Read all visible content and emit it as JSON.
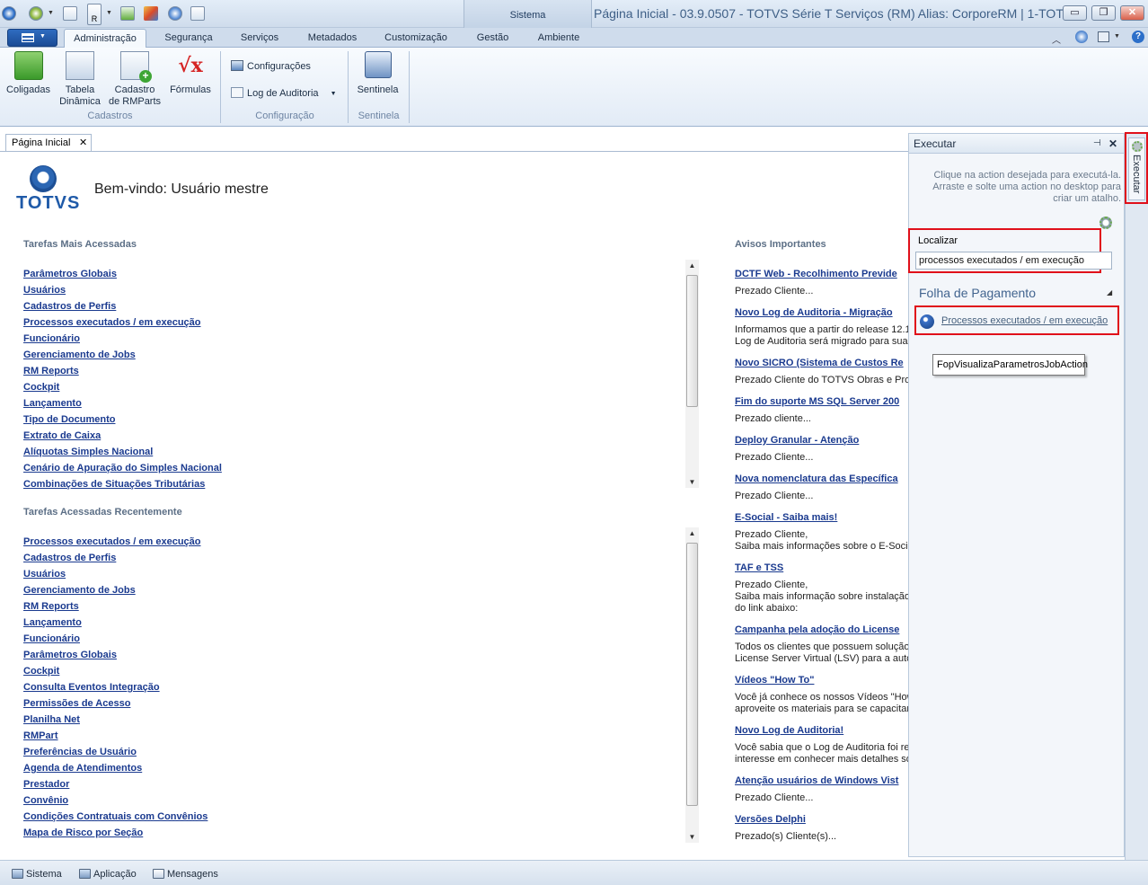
{
  "window": {
    "title": "Página Inicial - 03.9.0507 - TOTVS Série T Serviços (RM) Alias: CorporeRM | 1-TOT...",
    "context_tab": "Sistema",
    "controls": {
      "minimize": "▭",
      "restore": "❐",
      "close": "✕"
    }
  },
  "quick_access": {
    "r_badge": "R"
  },
  "ribbon": {
    "tabs": [
      {
        "label": "Administração"
      },
      {
        "label": "Segurança"
      },
      {
        "label": "Serviços"
      },
      {
        "label": "Metadados"
      },
      {
        "label": "Customização"
      },
      {
        "label": "Gestão"
      },
      {
        "label": "Ambiente"
      }
    ],
    "groups": {
      "cadastros": {
        "caption": "Cadastros",
        "coligadas": "Coligadas",
        "tabela_1": "Tabela",
        "tabela_2": "Dinâmica",
        "cadastro_1": "Cadastro",
        "cadastro_2": "de RMParts",
        "formulas": "Fórmulas"
      },
      "configuracao": {
        "caption": "Configuração",
        "configuracoes": "Configurações",
        "log_auditoria": "Log de Auditoria"
      },
      "sentinela": {
        "caption": "Sentinela",
        "sentinela": "Sentinela"
      }
    }
  },
  "doc_tab": {
    "label": "Página Inicial",
    "close": "✕"
  },
  "home": {
    "logo_text": "TOTVS",
    "welcome": "Bem-vindo: Usuário mestre",
    "most_accessed_title": "Tarefas Mais Acessadas",
    "most_accessed": [
      "Parâmetros Globais",
      "Usuários",
      "Cadastros de Perfis",
      "Processos executados / em execução",
      "Funcionário",
      "Gerenciamento de Jobs",
      "RM Reports",
      "Cockpit",
      "Lançamento",
      "Tipo de Documento",
      "Extrato de Caixa",
      "Alíquotas Simples Nacional",
      "Cenário de Apuração do Simples Nacional",
      "Combinações de Situações Tributárias"
    ],
    "recent_title": "Tarefas Acessadas Recentemente",
    "recent": [
      "Processos executados / em execução",
      "Cadastros de Perfis",
      "Usuários",
      "Gerenciamento de Jobs",
      "RM Reports",
      "Lançamento",
      "Funcionário",
      "Parâmetros Globais",
      "Cockpit",
      "Consulta Eventos Integração",
      "Permissões de Acesso",
      "Planilha Net",
      "RMPart",
      "Preferências de Usuário",
      "Agenda de Atendimentos",
      "Prestador",
      "Convênio",
      "Condições Contratuais com Convênios",
      "Mapa de Risco por Seção"
    ],
    "notices_title": "Avisos Importantes",
    "notices": [
      {
        "title": "DCTF Web - Recolhimento Previde",
        "body": [
          "Prezado Cliente..."
        ]
      },
      {
        "title": "Novo Log de Auditoria - Migração",
        "body": [
          "Informamos que a partir do release 12.1",
          "Log de Auditoria será migrado para sua"
        ]
      },
      {
        "title": "Novo SICRO (Sistema de Custos Re",
        "body": [
          "Prezado Cliente do TOTVS Obras e Proje"
        ]
      },
      {
        "title": "Fim do suporte MS SQL Server 200",
        "body": [
          "Prezado cliente..."
        ]
      },
      {
        "title": "Deploy Granular - Atenção",
        "body": [
          "Prezado Cliente..."
        ]
      },
      {
        "title": "Nova nomenclatura das Específica",
        "body": [
          "Prezado Cliente..."
        ]
      },
      {
        "title": "E-Social - Saiba mais!",
        "body": [
          "Prezado Cliente,",
          "Saiba mais informações sobre o E-Social"
        ]
      },
      {
        "title": "TAF e TSS",
        "body": [
          "Prezado Cliente,",
          "Saiba mais informação sobre instalação d",
          "do link abaixo:"
        ]
      },
      {
        "title": "Campanha pela adoção do License",
        "body": [
          "Todos os clientes que possuem solução d",
          "License  Server  Virtual (LSV) para a auto"
        ]
      },
      {
        "title": "Vídeos \"How To\"",
        "body": [
          "Você já conhece os nossos Vídeos \"How",
          "aproveite os materiais para se capacitar"
        ]
      },
      {
        "title": "Novo Log de Auditoria!",
        "body": [
          "Você sabia que o Log de Auditoria foi rev",
          "interesse em conhecer mais detalhes sob"
        ]
      },
      {
        "title": "Atenção usuários de Windows Vist",
        "body": [
          "Prezado Cliente..."
        ]
      },
      {
        "title": "Versões Delphi",
        "body": [
          "Prezado(s) Cliente(s)..."
        ]
      }
    ]
  },
  "execute_panel": {
    "title": "Executar",
    "pin": "⊣",
    "close": "✕",
    "hint": "Clique na action desejada para executá-la. Arraste e solte uma action no desktop para criar um atalho.",
    "search_label": "Localizar",
    "search_value": "processos executados / em execução",
    "group_title": "Folha de Pagamento",
    "result": "Processos executados / em execução",
    "tooltip": "FopVisualizaParametrosJobAction"
  },
  "dock": {
    "label": "Executar"
  },
  "statusbar": {
    "items": [
      "Sistema",
      "Aplicação",
      "Mensagens"
    ]
  }
}
